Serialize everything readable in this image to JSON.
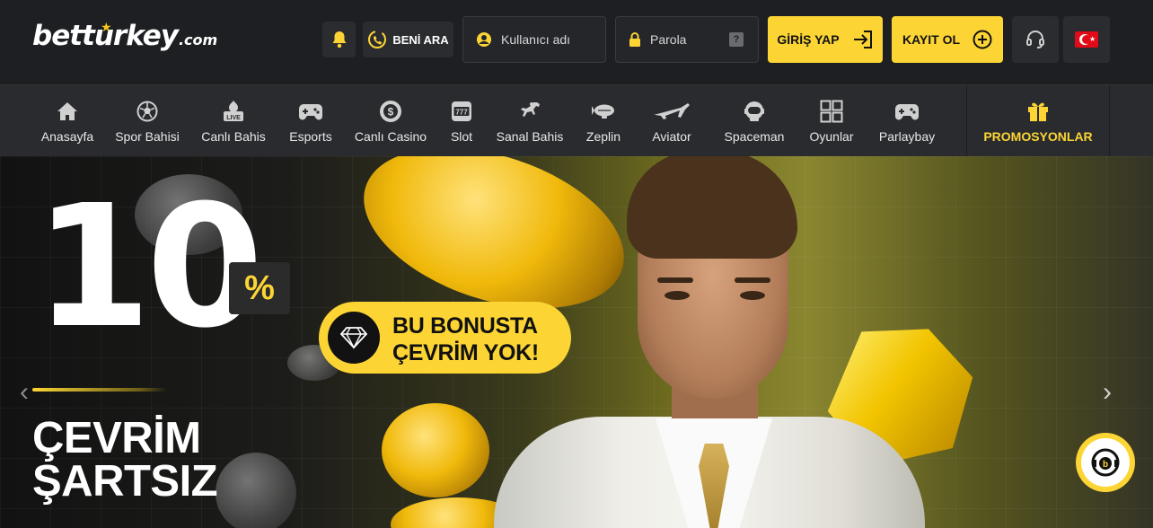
{
  "header": {
    "logo_text": "betturkey",
    "logo_suffix": ".com",
    "call_label": "BENİ ARA",
    "username_placeholder": "Kullanıcı adı",
    "password_placeholder": "Parola",
    "password_help": "?",
    "login_label": "GİRİŞ YAP",
    "register_label": "KAYIT OL",
    "language": "TR"
  },
  "nav": {
    "items": [
      {
        "label": "Anasayfa",
        "icon": "home-icon"
      },
      {
        "label": "Spor Bahisi",
        "icon": "soccer-ball-icon"
      },
      {
        "label": "Canlı Bahis",
        "icon": "live-tv-icon"
      },
      {
        "label": "Esports",
        "icon": "gamepad-icon"
      },
      {
        "label": "Canlı Casino",
        "icon": "casino-chip-icon"
      },
      {
        "label": "Slot",
        "icon": "slot-machine-icon"
      },
      {
        "label": "Sanal Bahis",
        "icon": "horse-icon"
      },
      {
        "label": "Zeplin",
        "icon": "zeppelin-icon"
      },
      {
        "label": "Aviator",
        "icon": "airplane-icon"
      },
      {
        "label": "Spaceman",
        "icon": "astronaut-icon"
      },
      {
        "label": "Oyunlar",
        "icon": "grid-icon"
      },
      {
        "label": "Parlaybay",
        "icon": "gamepad-icon"
      }
    ],
    "promo_label": "PROMOSYONLAR"
  },
  "hero": {
    "big_number": "10",
    "percent": "%",
    "pill_line1": "BU BONUSTA",
    "pill_line2": "ÇEVRİM YOK!",
    "headline_line1": "ÇEVRİM",
    "headline_line2": "ŞARTSIZ"
  },
  "colors": {
    "accent": "#fcd535",
    "header_bg": "#1e1f22",
    "nav_bg": "#2a2b2f"
  }
}
